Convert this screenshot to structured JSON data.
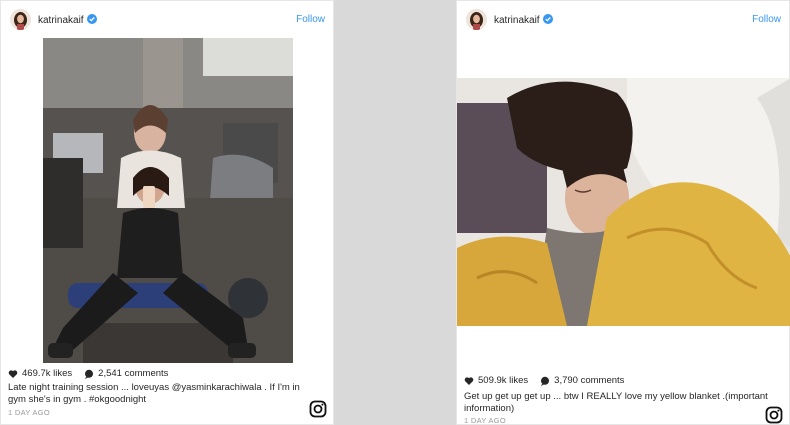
{
  "posts": [
    {
      "username": "katrinakaif",
      "follow_label": "Follow",
      "likes": "469.7k likes",
      "comments": "2,541 comments",
      "caption": "Late night training session ... loveuyas @yasminkarachiwala . If I'm in gym she's in gym . #okgoodnight",
      "timestamp": "1 DAY AGO",
      "photo_icon": "gym-mirror-selfie-photo"
    },
    {
      "username": "katrinakaif",
      "follow_label": "Follow",
      "likes": "509.9k likes",
      "comments": "3,790 comments",
      "caption": "Get up get up get up ... btw I REALLY love my yellow blanket .(important information)",
      "timestamp": "1 DAY AGO",
      "photo_icon": "sleeping-yellow-blanket-photo"
    }
  ],
  "colors": {
    "link": "#3897f0",
    "verified": "#3897f0",
    "text": "#262626",
    "muted": "#999999",
    "background": "#d9d9d9"
  },
  "icons": [
    "verified-badge-icon",
    "heart-icon",
    "comment-icon",
    "instagram-icon"
  ]
}
